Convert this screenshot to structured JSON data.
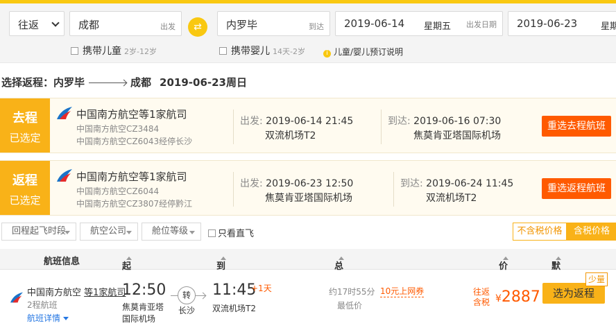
{
  "search": {
    "trip_type": "往返",
    "from_city": "成都",
    "from_label": "出发",
    "swap_icon": "⇄",
    "to_city": "内罗毕",
    "to_label": "到达",
    "depart_date": "2019-06-14",
    "depart_week": "星期五",
    "depart_label": "出发日期",
    "return_date": "2019-06-23",
    "return_week": "星期",
    "child_label": "携带儿童",
    "child_age": "2岁-12岁",
    "infant_label": "携带婴儿",
    "infant_age": "14天-2岁",
    "note_icon": "i",
    "note": "儿童/婴儿预订说明"
  },
  "route": {
    "prefix": "选择返程：内罗毕",
    "dest": "成都",
    "date": "2019-06-23周日"
  },
  "legs": [
    {
      "tag_title": "去程",
      "tag_status": "已选定",
      "airline": "中国南方航空等1家航司",
      "flight1": "中国南方航空CZ3484",
      "flight2": "中国南方航空CZ6043经停长沙",
      "dep_label": "出发:",
      "dep_time": "2019-06-14 21:45",
      "dep_airport": "双流机场T2",
      "arr_label": "到达:",
      "arr_time": "2019-06-16 07:30",
      "arr_airport": "焦莫肯亚塔国际机场",
      "button": "重选去程航班"
    },
    {
      "tag_title": "返程",
      "tag_status": "已选定",
      "airline": "中国南方航空等1家航司",
      "flight1": "中国南方航空CZ6044",
      "flight2": "中国南方航空CZ3807经停黔江",
      "dep_label": "出发:",
      "dep_time": "2019-06-23 12:50",
      "dep_airport": "焦莫肯亚塔国际机场",
      "arr_label": "到达:",
      "arr_time": "2019-06-24 11:45",
      "arr_airport": "双流机场T2",
      "button": "重选返程航班"
    }
  ],
  "filters": {
    "depart_period": "回程起飞时段",
    "airline": "航空公司",
    "cabin": "舱位等级",
    "direct_only": "只看直飞",
    "price_excl_tax": "不含税价格",
    "price_incl_tax": "含税价格"
  },
  "table_header": {
    "info": "航班信息",
    "dep_time": "起飞时间",
    "arr_time": "到达时间",
    "duration": "总耗时",
    "price": "价格",
    "sort": "默认排序"
  },
  "flight_row": {
    "airline_main": "中国南方航空",
    "airline_more": "等1家航司",
    "legs_count": "2程航班",
    "details": "航班详情",
    "dep_time": "12:50",
    "dep_airport": "焦莫肯亚塔国际机场",
    "stop_label": "转",
    "stop_city": "长沙",
    "arr_time": "11:45",
    "arr_plus": "+1天",
    "arr_airport": "双流机场T2",
    "duration": "约17时55分",
    "lowest": "最低价",
    "coupon": "10元上网券",
    "price_tag1": "往返",
    "price_tag2": "含税",
    "currency": "¥",
    "price": "2887",
    "choose_button": "选为返程",
    "few_seats": "少量"
  },
  "colors": {
    "brand_yellow": "#f9c811",
    "tag_orange": "#f9b218",
    "action_orange": "#ff5a00",
    "link_blue": "#2577e3"
  }
}
